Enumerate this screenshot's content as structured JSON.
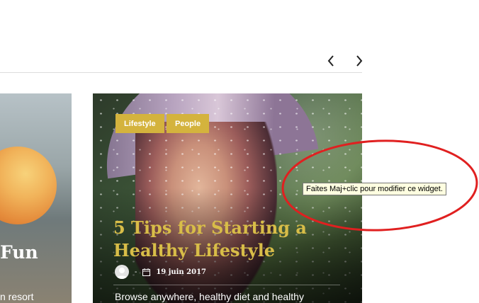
{
  "icons": {
    "prev": "chevron-left-icon",
    "next": "chevron-right-icon",
    "calendar": "calendar-icon",
    "author": "user-avatar-icon"
  },
  "colors": {
    "tag_bg": "#d4b33d",
    "title": "#d8bd48",
    "annotation": "#e02020",
    "tooltip_bg": "#fefee0"
  },
  "slider": {
    "left_card": {
      "title_fragment": "Fun",
      "excerpt_fragment": "n resort"
    },
    "main_card": {
      "tags": [
        "Lifestyle",
        "People"
      ],
      "title": "5 Tips for Starting a Healthy Lifestyle",
      "separator": "-",
      "date": "19 juin 2017",
      "excerpt": "Browse anywhere, healthy diet and healthy"
    }
  },
  "tooltip": {
    "text": "Faites Maj+clic pour modifier ce widget."
  }
}
